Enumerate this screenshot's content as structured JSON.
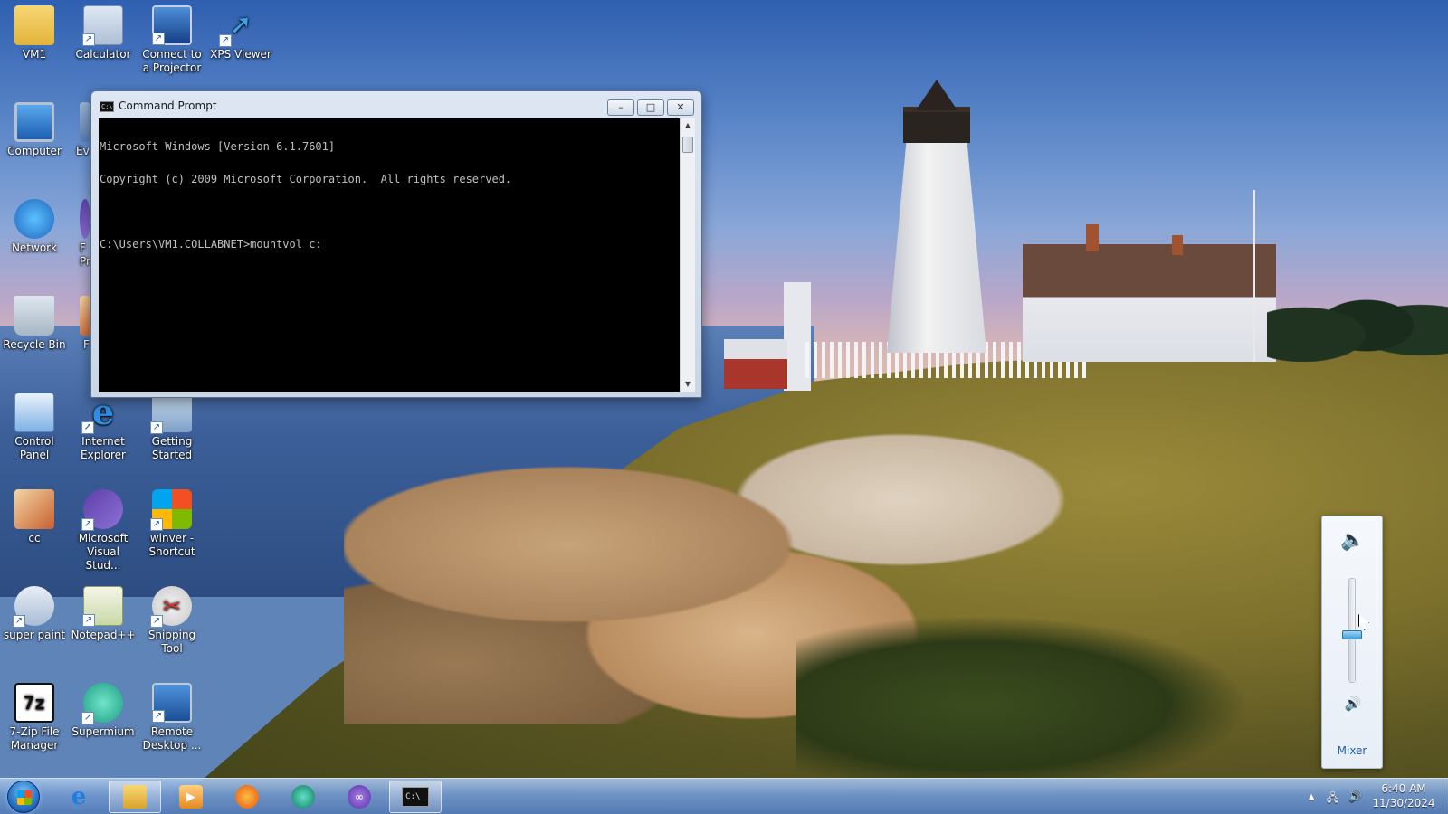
{
  "desktop": {
    "icons": [
      {
        "label": "VM1",
        "icon": "folder-user-icon"
      },
      {
        "label": "Calculator",
        "icon": "calculator-icon"
      },
      {
        "label": "Connect to a Projector",
        "icon": "projector-icon"
      },
      {
        "label": "XPS Viewer",
        "icon": "xps-viewer-icon"
      },
      {
        "label": "Computer",
        "icon": "computer-icon"
      },
      {
        "label": "Ev",
        "icon": "event-viewer-icon"
      },
      {
        "label": "Network",
        "icon": "network-icon"
      },
      {
        "label": "F Pr",
        "icon": "program-icon"
      },
      {
        "label": "Recycle Bin",
        "icon": "recycle-bin-icon"
      },
      {
        "label": "F",
        "icon": "program-icon"
      },
      {
        "label": "Control Panel",
        "icon": "control-panel-icon"
      },
      {
        "label": "Internet Explorer",
        "icon": "internet-explorer-icon"
      },
      {
        "label": "Getting Started",
        "icon": "getting-started-icon"
      },
      {
        "label": "cc",
        "icon": "cc-icon"
      },
      {
        "label": "Microsoft Visual Stud...",
        "icon": "visual-studio-icon"
      },
      {
        "label": "winver - Shortcut",
        "icon": "windows-flag-icon"
      },
      {
        "label": "super paint",
        "icon": "paint-icon"
      },
      {
        "label": "Notepad++",
        "icon": "notepad-plus-plus-icon"
      },
      {
        "label": "Snipping Tool",
        "icon": "snipping-tool-icon"
      },
      {
        "label": "7-Zip File Manager",
        "icon": "seven-zip-icon"
      },
      {
        "label": "Supermium",
        "icon": "supermium-icon"
      },
      {
        "label": "Remote Desktop ...",
        "icon": "remote-desktop-icon"
      }
    ],
    "zip_glyph": "7z"
  },
  "cmd_window": {
    "title": "Command Prompt",
    "icon_glyph": "C:\\",
    "buttons": {
      "minimize": "–",
      "maximize": "□",
      "close": "✕"
    },
    "console_lines": [
      "Microsoft Windows [Version 6.1.7601]",
      "Copyright (c) 2009 Microsoft Corporation.  All rights reserved.",
      "",
      "C:\\Users\\VM1.COLLABNET>mountvol c:"
    ],
    "scroll_up": "▲",
    "scroll_down": "▼"
  },
  "volume_flyout": {
    "level": 0.45,
    "mixer_label": "Mixer",
    "device_icon": "speaker-device-icon",
    "mute_icon": "speaker-icon",
    "mute_glyph": "🔊",
    "device_glyph": "🔈"
  },
  "taskbar": {
    "pinned": [
      {
        "name": "internet-explorer",
        "glyph": "e"
      },
      {
        "name": "windows-explorer",
        "glyph": ""
      },
      {
        "name": "media-player",
        "glyph": "▶"
      },
      {
        "name": "firefox",
        "glyph": ""
      },
      {
        "name": "supermium",
        "glyph": ""
      },
      {
        "name": "visual-studio",
        "glyph": "∞"
      },
      {
        "name": "command-prompt",
        "glyph": "C:\\_"
      }
    ],
    "tray": {
      "show_hidden": "▲",
      "network_glyph": "🖧",
      "volume_glyph": "🔊"
    },
    "clock": {
      "time": "6:40 AM",
      "date": "11/30/2024"
    }
  }
}
